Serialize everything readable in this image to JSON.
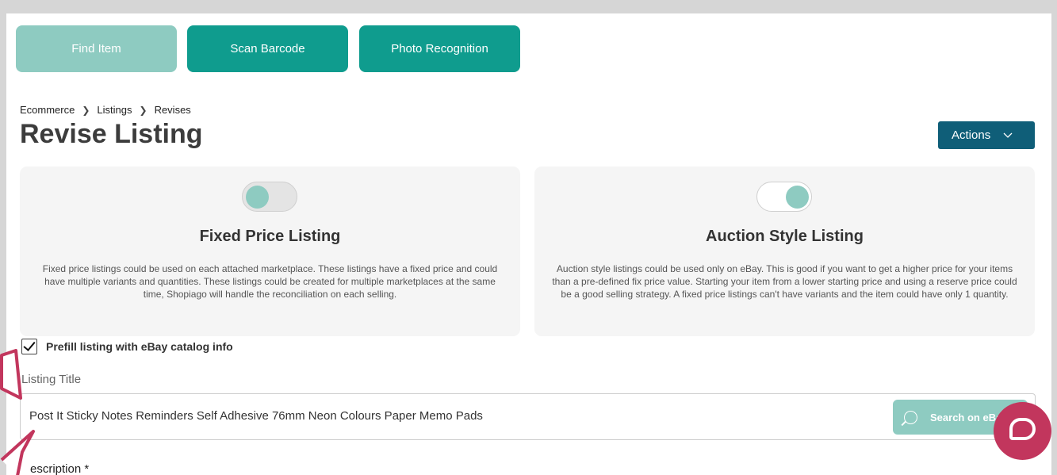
{
  "top_buttons": {
    "find_item": "Find Item",
    "scan_barcode": "Scan Barcode",
    "photo_recognition": "Photo Recognition"
  },
  "breadcrumb": [
    "Ecommerce",
    "Listings",
    "Revises"
  ],
  "page_title": "Revise Listing",
  "actions_label": "Actions",
  "cards": {
    "fixed": {
      "title": "Fixed Price Listing",
      "description": "Fixed price listings could be used on each attached marketplace. These listings have a fixed price and could have multiple variants and quantities. These listings could be created for multiple marketplaces at the same time, Shopiago will handle the reconciliation on each selling.",
      "toggle_on": false
    },
    "auction": {
      "title": "Auction Style Listing",
      "description": "Auction style listings could be used only on eBay. This is good if you want to get a higher price for your items than a pre-defined fix price value. Starting your item from a lower starting price and using a reserve price could be a good selling strategy. A fixed price listings can't have variants and the item could have only 1 quantity.",
      "toggle_on": true
    }
  },
  "prefill": {
    "label": "Prefill listing with eBay catalog info",
    "checked": true
  },
  "listing_title": {
    "label": "Listing Title",
    "value": "Post It Sticky Notes Reminders Self Adhesive 76mm Neon Colours Paper Memo Pads",
    "search_button": "Search on eBay"
  },
  "description_label": "escription *",
  "colors": {
    "teal": "#0f9c8e",
    "teal_light": "#8ecbc1",
    "navy": "#0f5e78",
    "chat": "#c2365d",
    "pointer": "#c2365d"
  },
  "icons": [
    "search-icon",
    "chevron-down-icon",
    "chevron-right-icon",
    "check-icon",
    "chat-icon",
    "pointer-arrow-icon"
  ]
}
